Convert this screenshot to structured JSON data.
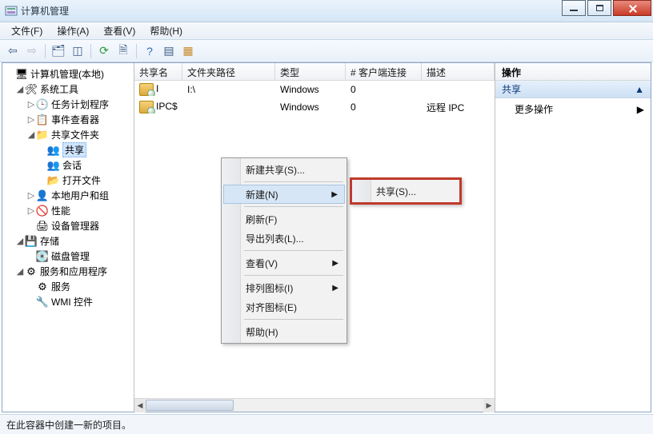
{
  "window": {
    "title": "计算机管理"
  },
  "menubar": {
    "file": "文件(F)",
    "action": "操作(A)",
    "view": "查看(V)",
    "help": "帮助(H)"
  },
  "tree": {
    "root": "计算机管理(本地)",
    "system_tools": "系统工具",
    "task_scheduler": "任务计划程序",
    "event_viewer": "事件查看器",
    "shared_folders": "共享文件夹",
    "shares": "共享",
    "sessions": "会话",
    "open_files": "打开文件",
    "local_users": "本地用户和组",
    "performance": "性能",
    "device_manager": "设备管理器",
    "storage": "存储",
    "disk_management": "磁盘管理",
    "services_apps": "服务和应用程序",
    "services": "服务",
    "wmi": "WMI 控件"
  },
  "columns": {
    "share_name": "共享名",
    "folder_path": "文件夹路径",
    "type": "类型",
    "clients": "# 客户端连接",
    "description": "描述"
  },
  "colw": {
    "share_name": 60,
    "folder_path": 116,
    "type": 88,
    "clients": 95,
    "description": 75
  },
  "rows": [
    {
      "name": "I",
      "path": "I:\\",
      "type": "Windows",
      "clients": "0",
      "desc": ""
    },
    {
      "name": "IPC$",
      "path": "",
      "type": "Windows",
      "clients": "0",
      "desc": "远程 IPC"
    }
  ],
  "actions": {
    "header": "操作",
    "section": "共享",
    "more": "更多操作"
  },
  "context": {
    "new_share": "新建共享(S)...",
    "new": "新建(N)",
    "refresh": "刷新(F)",
    "export_list": "导出列表(L)...",
    "view": "查看(V)",
    "arrange_icons": "排列图标(I)",
    "align_icons": "对齐图标(E)",
    "help": "帮助(H)"
  },
  "submenu": {
    "share": "共享(S)..."
  },
  "statusbar": "在此容器中创建一新的项目。"
}
